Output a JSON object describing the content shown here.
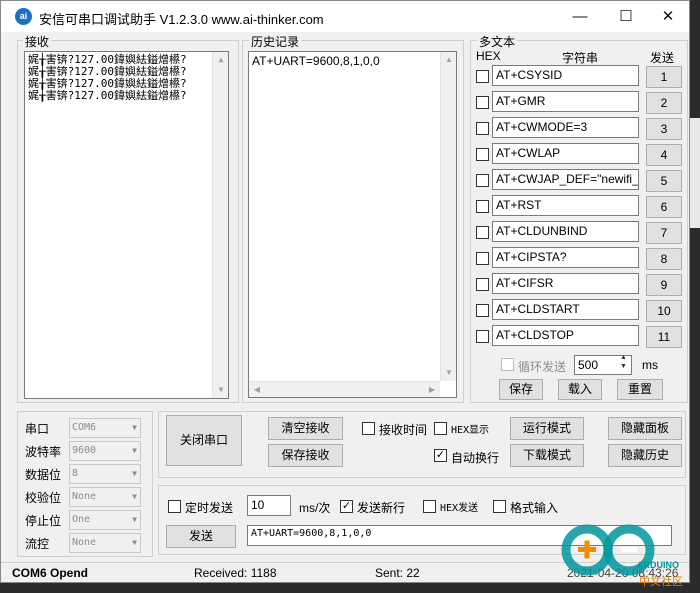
{
  "titlebar": {
    "icon_text": "ai",
    "title": "安信可串口调试助手 V1.2.3.0    www.ai-thinker.com",
    "minimize": "—",
    "maximize": "☐",
    "close": "✕"
  },
  "receive": {
    "label": "接收",
    "lines": [
      "娓╁害锛?127.00鍏嬩紶鎰熷櫒?",
      "娓╁害锛?127.00鍏嬩紶鎰熷櫒?",
      "娓╁害锛?127.00鍏嬩紶鎰熷櫒?",
      "娓╁害锛?127.00鍏嬩紶鎰熷櫒?"
    ]
  },
  "history": {
    "label": "历史记录",
    "lines": [
      "AT+UART=9600,8,1,0,0"
    ]
  },
  "multi": {
    "label": "多文本",
    "hex_header": "HEX",
    "string_header": "字符串",
    "send_header": "发送",
    "rows": [
      {
        "text": "AT+CSYSID",
        "num": "1"
      },
      {
        "text": "AT+GMR",
        "num": "2"
      },
      {
        "text": "AT+CWMODE=3",
        "num": "3"
      },
      {
        "text": "AT+CWLAP",
        "num": "4"
      },
      {
        "text": "AT+CWJAP_DEF=\"newifi_",
        "num": "5"
      },
      {
        "text": "AT+RST",
        "num": "6"
      },
      {
        "text": "AT+CLDUNBIND",
        "num": "7"
      },
      {
        "text": "AT+CIPSTA?",
        "num": "8"
      },
      {
        "text": "AT+CIFSR",
        "num": "9"
      },
      {
        "text": "AT+CLDSTART",
        "num": "10"
      },
      {
        "text": "AT+CLDSTOP",
        "num": "11"
      }
    ],
    "loop_label": "循环发送",
    "interval": "500",
    "unit": "ms",
    "save": "保存",
    "load": "载入",
    "reset": "重置"
  },
  "port": {
    "fields": [
      {
        "label": "串口",
        "value": "COM6"
      },
      {
        "label": "波特率",
        "value": "9600"
      },
      {
        "label": "数据位",
        "value": "8"
      },
      {
        "label": "校验位",
        "value": "None"
      },
      {
        "label": "停止位",
        "value": "One"
      },
      {
        "label": "流控",
        "value": "None"
      }
    ]
  },
  "controls": {
    "close_port": "关闭串口",
    "clear_recv": "清空接收",
    "save_recv": "保存接收",
    "recv_time": "接收时间",
    "hex_show": "HEX显示",
    "auto_wrap": "自动换行",
    "run_mode": "运行模式",
    "download_mode": "下载模式",
    "hide_panel": "隐藏面板",
    "hide_history": "隐藏历史"
  },
  "send": {
    "timed_send": "定时发送",
    "interval": "10",
    "unit": "ms/次",
    "newline": "发送新行",
    "hex_send": "HEX发送",
    "format_input": "格式输入",
    "send_button": "发送",
    "content": "AT+UART=9600,8,1,0,0"
  },
  "status": {
    "port": "COM6 Opend",
    "received": "Received: 1188",
    "sent": "Sent: 22",
    "time": "2021-04-20 08:43:26"
  },
  "overlay": {
    "logo_text": "ARDUINO",
    "logo_sub": "中文社区",
    "logo_color": "#00979c"
  }
}
